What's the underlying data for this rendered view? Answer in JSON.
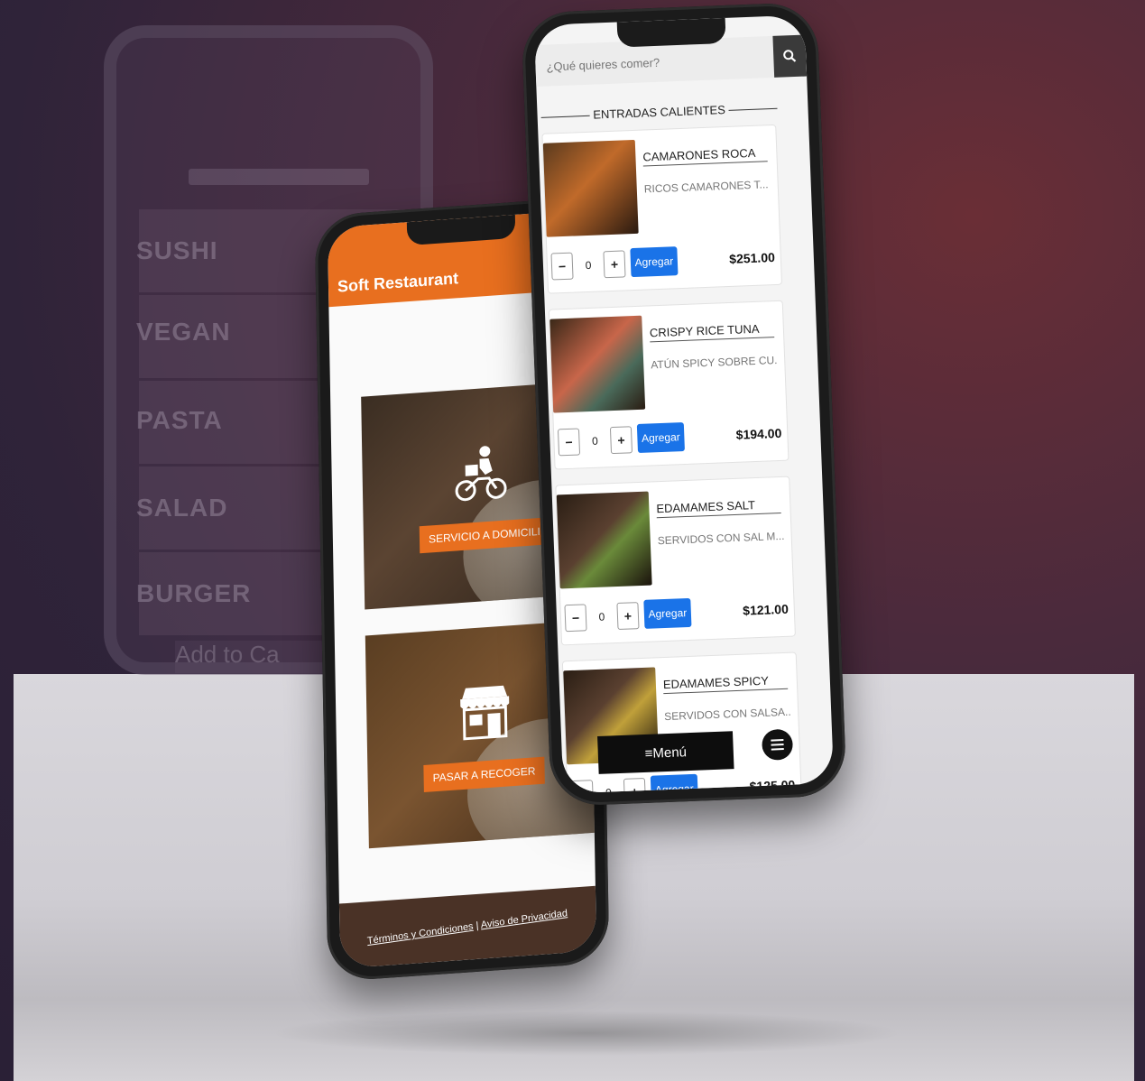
{
  "background": {
    "ghost_categories": [
      "SUSHI",
      "VEGAN",
      "PASTA",
      "SALAD",
      "BURGER"
    ],
    "ghost_add_to_cart": "Add to Ca"
  },
  "phone_left": {
    "brand": "Soft Restaurant",
    "accent_color": "#e86f1f",
    "delivery_button": "SERVICIO A DOMICILIO",
    "pickup_button": "PASAR A RECOGER",
    "footer": {
      "terms": "Términos y Condiciones",
      "separator": "|",
      "privacy": "Aviso de Privacidad"
    }
  },
  "phone_right": {
    "search": {
      "placeholder": "¿Qué quieres comer?"
    },
    "section_title": "ENTRADAS CALIENTES",
    "add_label": "Agregar",
    "items": [
      {
        "name": "CAMARONES ROCA",
        "desc": "RICOS CAMARONES T...",
        "qty": "0",
        "price": "$251.00"
      },
      {
        "name": "CRISPY RICE TUNA",
        "desc": "ATÚN SPICY SOBRE CU...",
        "qty": "0",
        "price": "$194.00"
      },
      {
        "name": "EDAMAMES SALT",
        "desc": "SERVIDOS CON SAL M...",
        "qty": "0",
        "price": "$121.00"
      },
      {
        "name": "EDAMAMES SPICY",
        "desc": "SERVIDOS CON SALSA...",
        "qty": "0",
        "price": "$125.00"
      }
    ],
    "menu_button": "≡Menú"
  }
}
